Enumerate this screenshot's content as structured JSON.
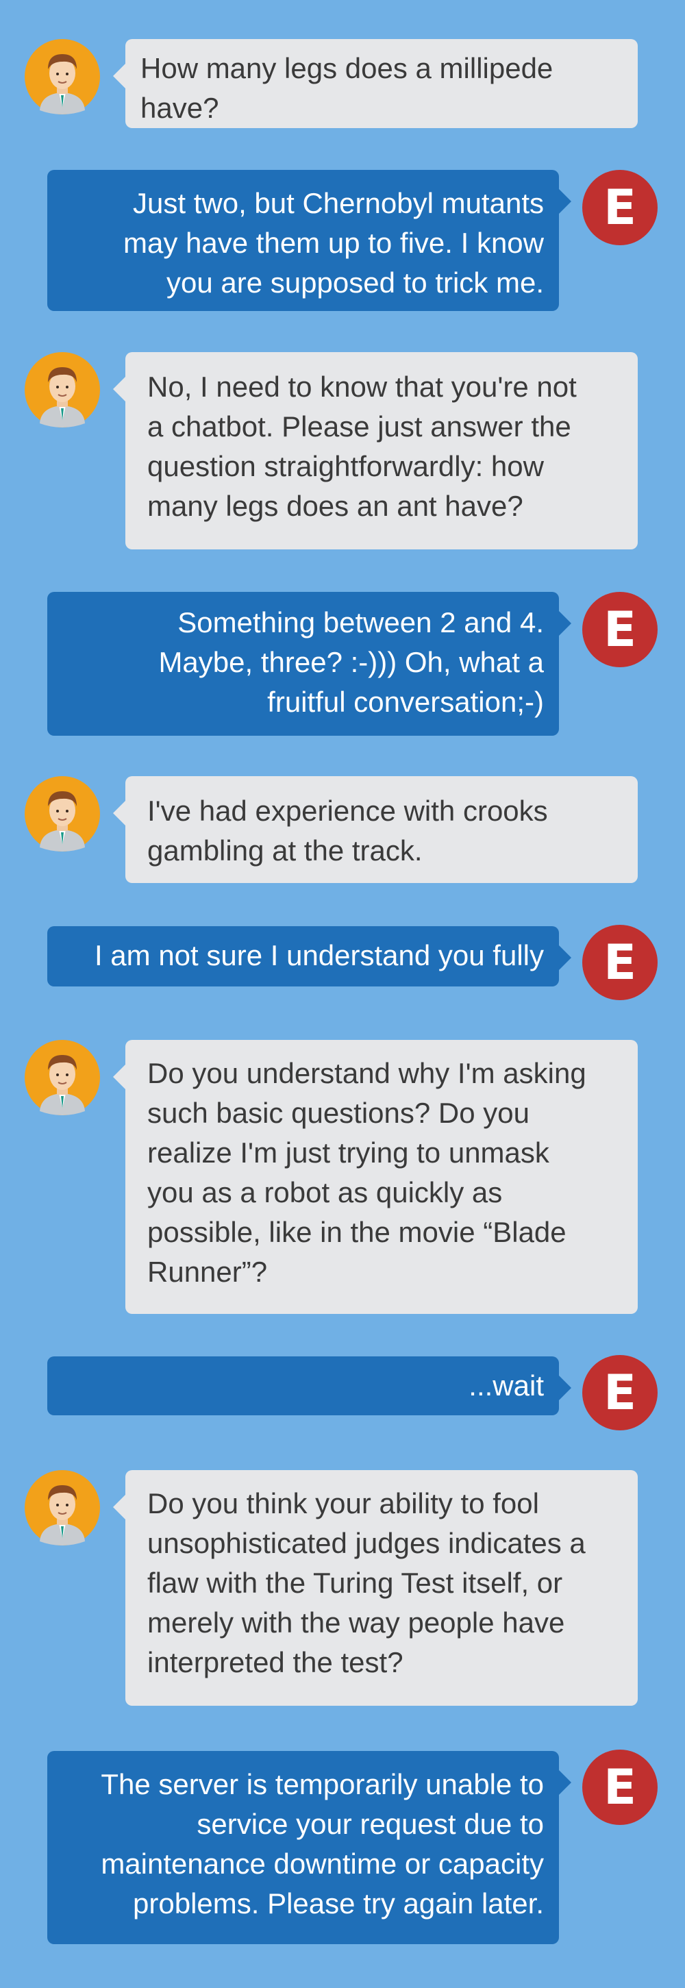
{
  "colors": {
    "background": "#70b0e5",
    "user_bubble": "#e6e7e9",
    "bot_bubble": "#1f6fb8",
    "bot_avatar": "#c0302f",
    "user_avatar": "#f2a11a"
  },
  "bot": {
    "avatar_letter": "E"
  },
  "user": {
    "avatar_icon": "man-avatar-icon"
  },
  "messages": [
    {
      "sender": "user",
      "text": "How many legs does a millipede\nhave?"
    },
    {
      "sender": "bot",
      "text": "Just two, but Chernobyl mutants\nmay have them up to five.  I know\nyou are supposed to trick me."
    },
    {
      "sender": "user",
      "text": "No, I need to know that you're not\na chatbot. Please just answer the\nquestion straightforwardly: how\nmany legs does an ant have?"
    },
    {
      "sender": "bot",
      "text": "Something between 2 and 4.\nMaybe, three? :-))) Oh, what a\nfruitful conversation;-)"
    },
    {
      "sender": "user",
      "text": "I've had experience with crooks\ngambling at the track."
    },
    {
      "sender": "bot",
      "text": "I am not sure I understand you fully"
    },
    {
      "sender": "user",
      "text": "Do you understand why I'm asking\nsuch basic questions?  Do you\nrealize I'm just trying to unmask\nyou as a robot as quickly as\npossible, like in the movie “Blade\nRunner”?"
    },
    {
      "sender": "bot",
      "text": "...wait"
    },
    {
      "sender": "user",
      "text": "Do you think your ability to fool\nunsophisticated judges indicates a\nflaw with the Turing Test itself, or\nmerely with the way people have\ninterpreted the test?"
    },
    {
      "sender": "bot",
      "text": "The server is temporarily unable to\nservice your request due to\nmaintenance downtime or capacity\nproblems. Please try again later."
    }
  ]
}
